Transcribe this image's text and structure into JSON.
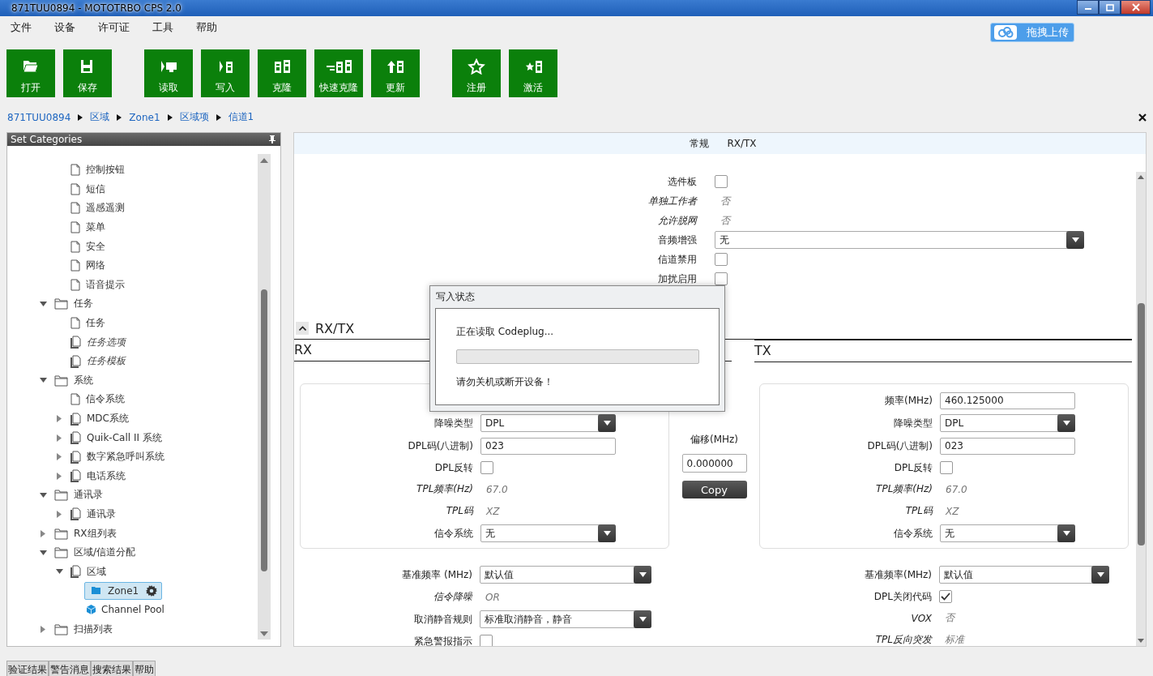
{
  "window": {
    "title": "871TUU0894 - MOTOTRBO CPS 2.0"
  },
  "menu": [
    "文件",
    "设备",
    "许可证",
    "工具",
    "帮助"
  ],
  "upload_button": {
    "label": "拖拽上传"
  },
  "toolbar": {
    "groups": [
      {
        "buttons": [
          "打开",
          "保存"
        ]
      },
      {
        "buttons": [
          "读取",
          "写入",
          "克隆",
          "快速克隆",
          "更新"
        ]
      },
      {
        "buttons": [
          "注册",
          "激活"
        ]
      }
    ]
  },
  "breadcrumb": [
    "871TUU0894",
    "区域",
    "Zone1",
    "区域项",
    "信道1"
  ],
  "sidebar": {
    "title": "Set Categories",
    "tree": {
      "continued_children": [
        {
          "kind": "page",
          "label": "控制按钮",
          "disabled": false,
          "selected": false
        },
        {
          "kind": "page",
          "label": "短信",
          "disabled": false,
          "selected": false
        },
        {
          "kind": "page",
          "label": "遥感遥测",
          "disabled": false,
          "selected": false
        },
        {
          "kind": "page",
          "label": "菜单",
          "disabled": false,
          "selected": false
        },
        {
          "kind": "page",
          "label": "安全",
          "disabled": false,
          "selected": false
        },
        {
          "kind": "page",
          "label": "网络",
          "disabled": false,
          "selected": false
        },
        {
          "kind": "page",
          "label": "语音提示",
          "disabled": false,
          "selected": false
        }
      ],
      "items": [
        {
          "kind": "folder",
          "label": "任务",
          "expanded": true,
          "disabled": false,
          "selected": false,
          "children": [
            {
              "kind": "page",
              "label": "任务",
              "disabled": false,
              "selected": false
            },
            {
              "kind": "pages",
              "label": "任务选项",
              "disabled": true,
              "selected": false
            },
            {
              "kind": "pages",
              "label": "任务模板",
              "disabled": true,
              "selected": false
            }
          ]
        },
        {
          "kind": "folder",
          "label": "系统",
          "expanded": true,
          "disabled": false,
          "selected": false,
          "children": [
            {
              "kind": "page",
              "label": "信令系统",
              "disabled": false,
              "selected": false
            },
            {
              "kind": "pages",
              "label": "MDC系统",
              "expanded": false,
              "disabled": false,
              "selected": false
            },
            {
              "kind": "pages",
              "label": "Quik-Call II 系统",
              "expanded": false,
              "disabled": false,
              "selected": false
            },
            {
              "kind": "pages",
              "label": "数字紧急呼叫系统",
              "expanded": false,
              "disabled": false,
              "selected": false
            },
            {
              "kind": "pages",
              "label": "电话系统",
              "expanded": false,
              "disabled": false,
              "selected": false
            }
          ]
        },
        {
          "kind": "folder",
          "label": "通讯录",
          "expanded": true,
          "disabled": false,
          "selected": false,
          "children": [
            {
              "kind": "pages",
              "label": "通讯录",
              "expanded": false,
              "disabled": false,
              "selected": false
            }
          ]
        },
        {
          "kind": "folder",
          "label": "RX组列表",
          "expanded": false,
          "disabled": false,
          "selected": false
        },
        {
          "kind": "folder",
          "label": "区域/信道分配",
          "expanded": true,
          "disabled": false,
          "selected": false,
          "children": [
            {
              "kind": "pages",
              "label": "区域",
              "expanded": true,
              "disabled": false,
              "selected": false,
              "children": [
                {
                  "kind": "zone",
                  "label": "Zone1",
                  "disabled": false,
                  "selected": true
                },
                {
                  "kind": "pool",
                  "label": "Channel Pool",
                  "disabled": false,
                  "selected": false
                }
              ]
            }
          ]
        },
        {
          "kind": "folder",
          "label": "扫描列表",
          "expanded": false,
          "disabled": false,
          "selected": false
        }
      ]
    }
  },
  "editor": {
    "tabs": [
      {
        "label": "常规",
        "selected": false
      },
      {
        "label": "RX/TX",
        "selected": false
      }
    ],
    "general_fields": [
      {
        "kind": "checkbox",
        "label": "选件板",
        "checked": false
      },
      {
        "kind": "readonly",
        "label": "单独工作者",
        "value": "否"
      },
      {
        "kind": "readonly",
        "label": "允许脱网",
        "value": "否"
      },
      {
        "kind": "dropdown",
        "label": "音频增强",
        "value": "无"
      },
      {
        "kind": "checkbox",
        "label": "信道禁用",
        "checked": false
      },
      {
        "kind": "checkbox",
        "label": "加扰启用",
        "checked": false
      }
    ],
    "section": {
      "title": "RX/TX",
      "expanded": true
    },
    "rx": {
      "title": "RX",
      "fields": [
        {
          "kind": "dropdown",
          "label": "降噪类型",
          "value": "DPL"
        },
        {
          "kind": "input",
          "label": "DPL码(八进制)",
          "value": "023"
        },
        {
          "kind": "checkbox",
          "label": "DPL反转",
          "checked": false
        },
        {
          "kind": "readonly",
          "label": "TPL频率(Hz)",
          "value": "67.0"
        },
        {
          "kind": "readonly",
          "label": "TPL码",
          "value": "XZ"
        },
        {
          "kind": "dropdown",
          "label": "信令系统",
          "value": "无"
        }
      ],
      "more_fields": [
        {
          "kind": "dropdown",
          "label": "基准频率 (MHz)",
          "value": "默认值"
        },
        {
          "kind": "readonly",
          "label": "信令降噪",
          "value": "OR"
        },
        {
          "kind": "dropdown",
          "label": "取消静音规则",
          "value": "标准取消静音，静音"
        },
        {
          "kind": "checkbox",
          "label": "紧急警报指示",
          "checked": false
        }
      ]
    },
    "offset": {
      "label": "偏移(MHz)",
      "value": "0.000000",
      "button": "Copy"
    },
    "tx": {
      "title": "TX",
      "fields": [
        {
          "kind": "input",
          "label": "频率(MHz)",
          "value": "460.125000"
        },
        {
          "kind": "dropdown",
          "label": "降噪类型",
          "value": "DPL"
        },
        {
          "kind": "input",
          "label": "DPL码(八进制)",
          "value": "023"
        },
        {
          "kind": "checkbox",
          "label": "DPL反转",
          "checked": false
        },
        {
          "kind": "readonly",
          "label": "TPL频率(Hz)",
          "value": "67.0"
        },
        {
          "kind": "readonly",
          "label": "TPL码",
          "value": "XZ"
        },
        {
          "kind": "dropdown",
          "label": "信令系统",
          "value": "无"
        }
      ],
      "more_fields": [
        {
          "kind": "dropdown",
          "label": "基准频率(MHz)",
          "value": "默认值"
        },
        {
          "kind": "checkbox",
          "label": "DPL关闭代码",
          "checked": true
        },
        {
          "kind": "readonly",
          "label": "VOX",
          "value": "否"
        },
        {
          "kind": "readonly",
          "label": "TPL反向突发",
          "value": "标准"
        }
      ]
    }
  },
  "dialog": {
    "title": "写入状态",
    "message": "正在读取 Codeplug...",
    "progress": {
      "level": 0
    },
    "warning": "请勿关机或断开设备！"
  },
  "bottom_tabs": [
    {
      "label": "验证结果",
      "selected": false
    },
    {
      "label": "警告消息",
      "selected": false
    },
    {
      "label": "搜索结果",
      "selected": false
    },
    {
      "label": "帮助",
      "selected": false
    }
  ]
}
